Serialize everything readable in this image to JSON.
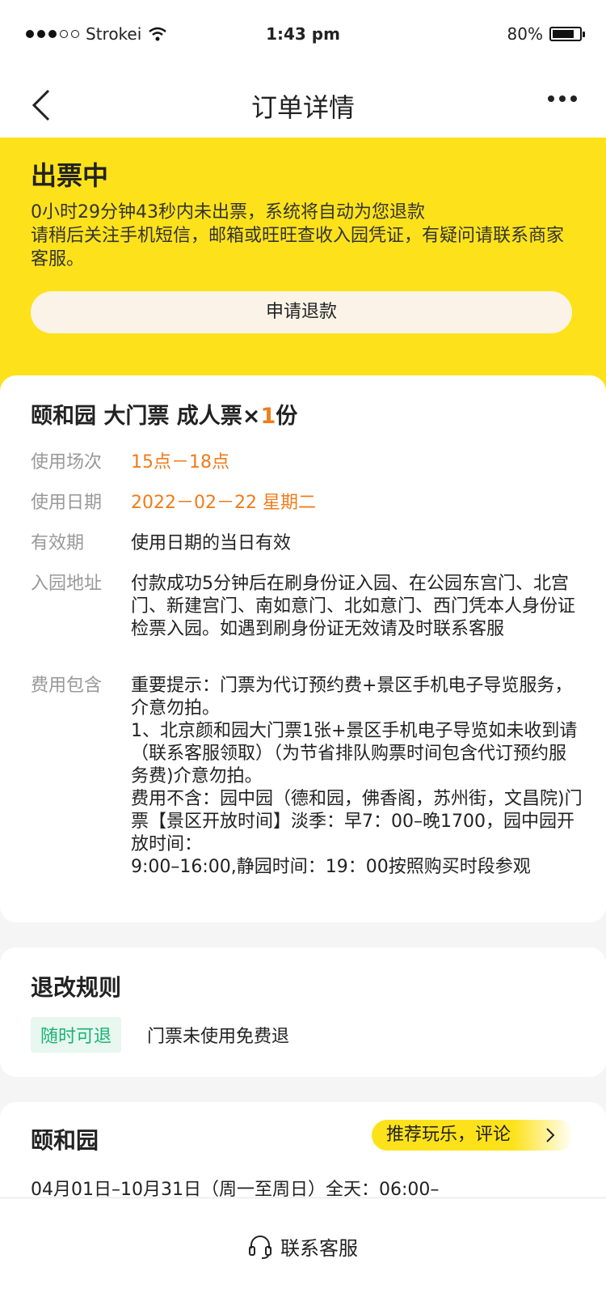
{
  "status_bar": {
    "carrier": "Strokei",
    "time": "1:43 pm",
    "battery": "80%"
  },
  "nav": {
    "title": "订单详情"
  },
  "banner": {
    "title": "出票中",
    "line1": "0小时29分钟43秒内未出票，系统将自动为您退款",
    "line2": "请稍后关注手机短信，邮箱或旺旺查收入园凭证，有疑问请联系商家客服。",
    "refund_button": "申请退款"
  },
  "ticket": {
    "title_prefix": "颐和园 大门票 成人票×",
    "quantity": "1",
    "title_suffix": "份",
    "rows": [
      {
        "label": "使用场次",
        "value": "15点－18点"
      },
      {
        "label": "使用日期",
        "value": "2022－02－22 星期二"
      },
      {
        "label": "有效期",
        "value": "使用日期的当日有效"
      },
      {
        "label": "入园地址",
        "value": "付款成功5分钟后在刷身份证入园、在公园东宫门、北宫门、新建宫门、南如意门、北如意门、西门凭本人身份证检票入园。如遇到刷身份证无效请及时联系客服"
      },
      {
        "label": "费用包含",
        "value": "重要提示：门票为代订预约费+景区手机电子导览服务，介意勿拍。\n1、北京颜和园大门票1张+景区手机电子导览如未收到请（联系客服领取）（为节省排队购票时间包含代订预约服务费)介意勿拍。\n费用不含：园中园（德和园，佛香阁，苏州街，文昌院)门票【景区开放时间】淡季：早7：00–晚1700，园中园开放时间：\n9:00–16:00,静园时间：19：00按照购买时段参观"
      }
    ]
  },
  "rules": {
    "title": "退改规则",
    "tag": "随时可退",
    "text": "门票未使用免费退"
  },
  "venue": {
    "title": "颐和园",
    "recommend_button": "推荐玩乐，评论",
    "hours": "04月01日–10月31日（周一至周日）全天：06:00–"
  },
  "bottom": {
    "service_label": "联系客服"
  },
  "colors": {
    "banner_yellow": "#fde21b",
    "accent_orange": "#f07c1a",
    "tag_green": "#1ab374"
  }
}
